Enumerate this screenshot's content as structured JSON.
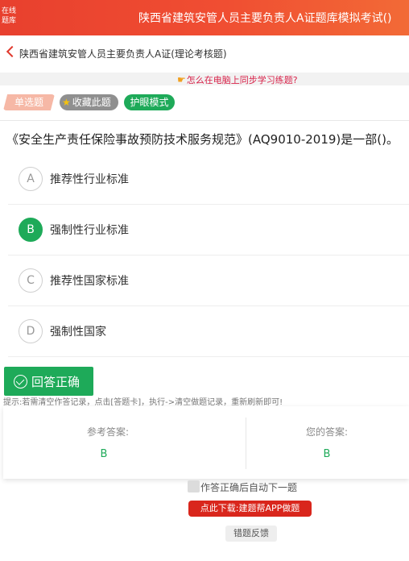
{
  "header": {
    "logo_line1": "在线",
    "logo_line2": "题库",
    "title": "陕西省建筑安管人员主要负责人A证题库模拟考试()"
  },
  "breadcrumb": {
    "back_icon": "chevron-left-icon",
    "text": "陕西省建筑安管人员主要负责人A证(理论考核题)"
  },
  "sync_banner": {
    "icon": "pointing-hand-icon",
    "link_text": "怎么在电脑上同步学习练题?"
  },
  "tags": {
    "type": "单选题",
    "favorite": "收藏此题",
    "eye_mode": "护眼模式"
  },
  "question": {
    "text": "《安全生产责任保险事故预防技术服务规范》(AQ9010-2019)是一部()。"
  },
  "options": [
    {
      "letter": "A",
      "text": "推荐性行业标准",
      "selected": false
    },
    {
      "letter": "B",
      "text": "强制性行业标准",
      "selected": true
    },
    {
      "letter": "C",
      "text": "推荐性国家标准",
      "selected": false
    },
    {
      "letter": "D",
      "text": "强制性国家",
      "selected": false
    }
  ],
  "result": {
    "icon": "check-circle-icon",
    "text": "回答正确"
  },
  "tip": "提示:若需清空作答记录，点击[答题卡]，执行->清空做题记录，重新刷新即可!",
  "answers": {
    "reference_label": "参考答案:",
    "reference_value": "B",
    "yours_label": "您的答案:",
    "yours_value": "B"
  },
  "auto_next": {
    "label": "作答正确后自动下一题",
    "checked": false
  },
  "download_button": "点此下载:建题帮APP做题",
  "feedback_button": "错题反馈",
  "colors": {
    "brand_red": "#e8402e",
    "correct_green": "#1eaa59",
    "link_pink": "#d8234a",
    "download_red": "#d9261c"
  }
}
